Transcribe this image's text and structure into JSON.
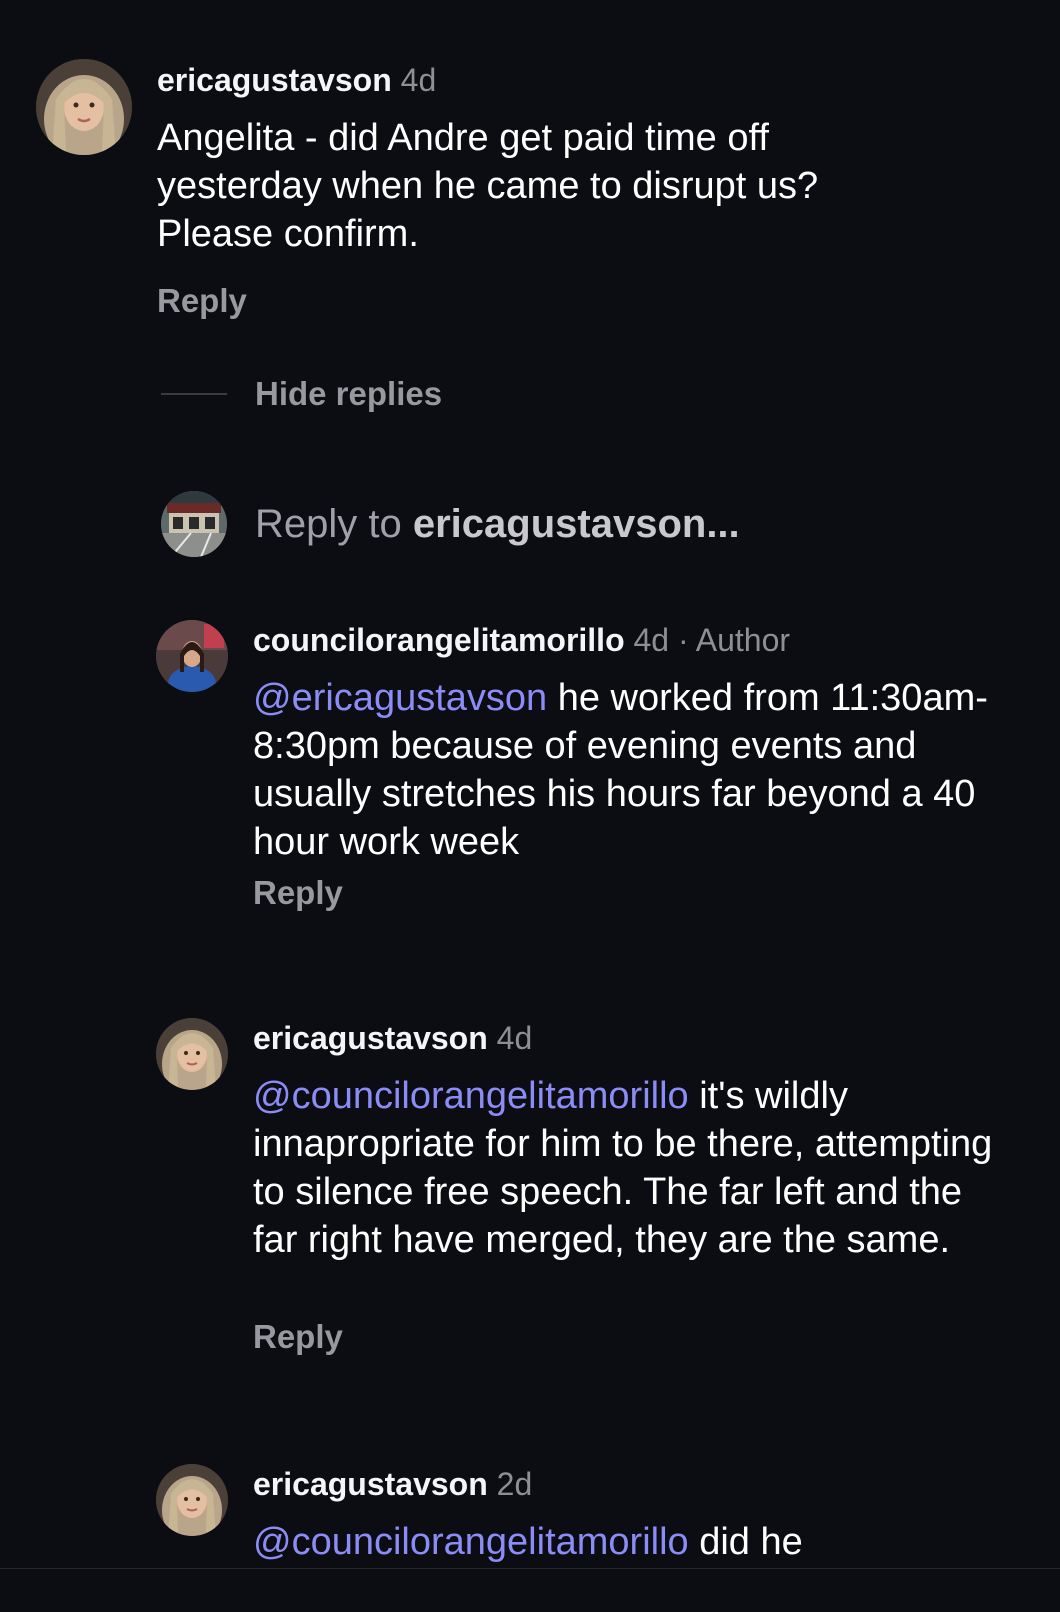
{
  "comments": [
    {
      "username": "ericagustavson",
      "time": "4d",
      "text": "Angelita - did Andre get paid time off yesterday when he came to disrupt us? Please confirm.",
      "reply_label": "Reply"
    }
  ],
  "thread_controls": {
    "hide_replies_label": "Hide replies",
    "reply_to_prefix": "Reply to ",
    "reply_to_user": "ericagustavson..."
  },
  "replies": [
    {
      "username": "councilorangelitamorillo",
      "time": "4d",
      "author_tag": "· Author",
      "mention": "@ericagustavson",
      "text": " he worked from 11:30am-8:30pm because of evening events and usually stretches his hours far beyond a 40 hour work week",
      "reply_label": "Reply"
    },
    {
      "username": "ericagustavson",
      "time": "4d",
      "mention": "@councilorangelitamorillo",
      "text": " it's wildly innapropriate for him to be there, attempting to silence free speech. The far left and the far right have merged, they are the same.",
      "reply_label": "Reply"
    },
    {
      "username": "ericagustavson",
      "time": "2d",
      "mention": "@councilorangelitamorillo",
      "text": " did he"
    }
  ],
  "colors": {
    "background": "#0b0d13",
    "mention": "#8b8cf5",
    "secondary_text": "#8e8e93",
    "action_text": "#98989f"
  },
  "icons": {
    "avatar_erica": "woman-portrait-avatar",
    "avatar_councilor": "woman-blue-jacket-avatar",
    "avatar_current_user": "storefront-photo-avatar"
  }
}
